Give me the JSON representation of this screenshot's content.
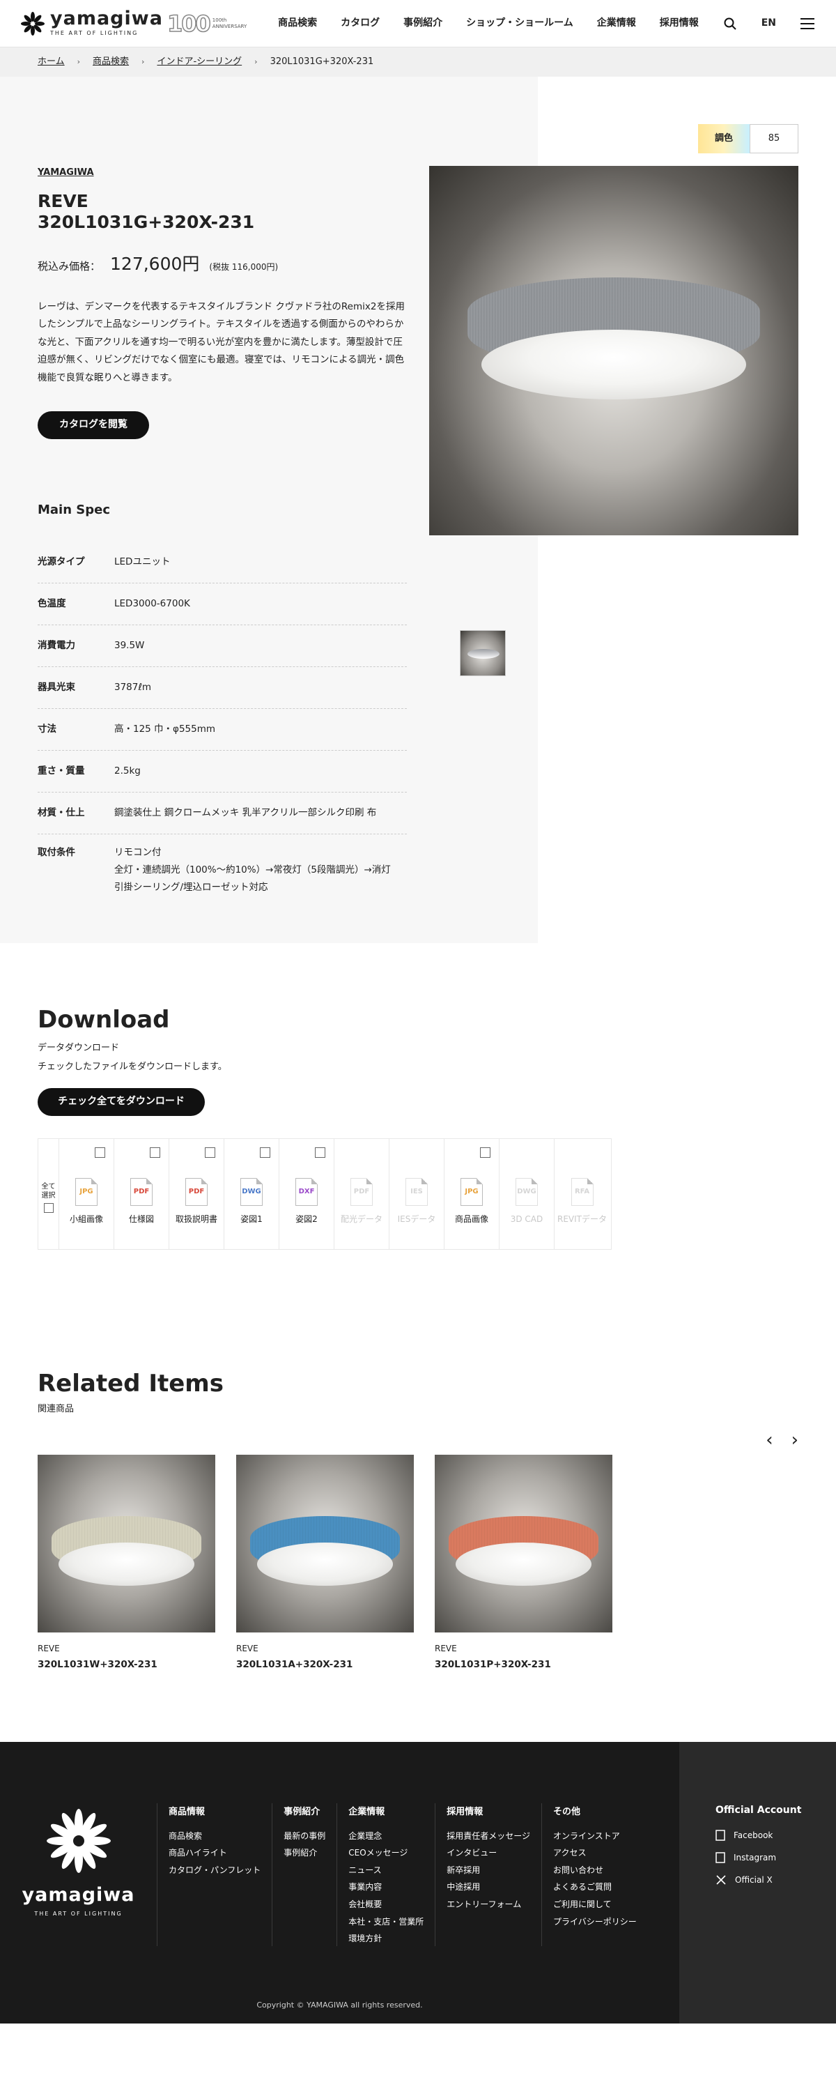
{
  "header": {
    "logo_text": "yamagiwa",
    "logo_sub": "THE ART OF LIGHTING",
    "anniv_number": "100",
    "anniv_text1": "100th",
    "anniv_text2": "ANNIVERSARY",
    "nav": [
      "商品検索",
      "カタログ",
      "事例紹介",
      "ショップ・ショールーム",
      "企業情報",
      "採用情報"
    ],
    "search_icon": "search-icon",
    "lang": "EN",
    "menu_icon": "menu-icon"
  },
  "breadcrumb": [
    "ホーム",
    "商品検索",
    "インドア-シーリング",
    "320L1031G+320X-231"
  ],
  "product": {
    "maker": "YAMAGIWA",
    "name_line1": "REVE",
    "name_line2": "320L1031G+320X-231",
    "price_label": "税込み価格：",
    "price": "127,600円",
    "price_sub": "(税抜 116,000円)",
    "description": "レーヴは、デンマークを代表するテキスタイルブランド クヴァドラ社のRemix2を採用したシンプルで上品なシーリングライト。テキスタイルを透過する側面からのやわらかな光と、下面アクリルを通す均一で明るい光が室内を豊かに満たします。薄型設計で圧迫感が無く、リビングだけでなく個室にも最適。寝室では、リモコンによる調光・調色機能で良質な眠りへと導きます。",
    "catalog_button": "カタログを閲覧",
    "color_label": "調色",
    "color_value": "85"
  },
  "spec": {
    "title": "Main Spec",
    "rows": [
      {
        "k": "光源タイプ",
        "v": "LEDユニット"
      },
      {
        "k": "色温度",
        "v": "LED3000-6700K"
      },
      {
        "k": "消費電力",
        "v": "39.5W"
      },
      {
        "k": "器具光束",
        "v": "3787ℓm"
      },
      {
        "k": "寸法",
        "v": "高・125 巾・φ555mm"
      },
      {
        "k": "重さ・質量",
        "v": "2.5kg"
      },
      {
        "k": "材質・仕上",
        "v": "鋼塗装仕上 鋼クロームメッキ 乳半アクリル一部シルク印刷 布"
      },
      {
        "k": "取付条件",
        "v1": "リモコン付",
        "v2": "全灯・連続調光（100%〜約10%）→常夜灯（5段階調光）→消灯",
        "v3": "引掛シーリング/埋込ローゼット対応"
      }
    ]
  },
  "download": {
    "title": "Download",
    "sub": "データダウンロード",
    "sub2": "チェックしたファイルをダウンロードします。",
    "button": "チェック全てをダウンロード",
    "select_all": "全て選択",
    "files": [
      {
        "type": "JPG",
        "label": "小組画像",
        "color": "#e8a33d",
        "enabled": true
      },
      {
        "type": "PDF",
        "label": "仕様図",
        "color": "#d84a3c",
        "enabled": true
      },
      {
        "type": "PDF",
        "label": "取扱説明書",
        "color": "#d84a3c",
        "enabled": true
      },
      {
        "type": "DWG",
        "label": "姿図1",
        "color": "#4a79c9",
        "enabled": true
      },
      {
        "type": "DXF",
        "label": "姿図2",
        "color": "#9a4ac9",
        "enabled": true
      },
      {
        "type": "PDF",
        "label": "配光データ",
        "color": "#d84a3c",
        "enabled": false
      },
      {
        "type": "IES",
        "label": "IESデータ",
        "color": "#4aa9c9",
        "enabled": false
      },
      {
        "type": "JPG",
        "label": "商品画像",
        "color": "#e8a33d",
        "enabled": true
      },
      {
        "type": "DWG",
        "label": "3D CAD",
        "color": "#4a79c9",
        "enabled": false
      },
      {
        "type": "RFA",
        "label": "REVITデータ",
        "color": "#4a79c9",
        "enabled": false
      }
    ]
  },
  "related": {
    "title": "Related Items",
    "sub": "関連商品",
    "prev_icon": "chevron-left-icon",
    "next_icon": "chevron-right-icon",
    "items": [
      {
        "maker": "REVE",
        "code": "320L1031W+320X-231",
        "color": "#d4d1bd"
      },
      {
        "maker": "REVE",
        "code": "320L1031A+320X-231",
        "color": "#4a8fc0"
      },
      {
        "maker": "REVE",
        "code": "320L1031P+320X-231",
        "color": "#d97a5f"
      }
    ]
  },
  "footer": {
    "logo_text": "yamagiwa",
    "logo_sub": "THE ART OF LIGHTING",
    "cols": [
      {
        "title": "商品情報",
        "links": [
          "商品検索",
          "商品ハイライト",
          "カタログ・パンフレット"
        ]
      },
      {
        "title": "事例紹介",
        "links": [
          "最新の事例",
          "事例紹介"
        ]
      },
      {
        "title": "企業情報",
        "links": [
          "企業理念",
          "CEOメッセージ",
          "ニュース",
          "事業内容",
          "会社概要",
          "本社・支店・営業所",
          "環境方針"
        ]
      },
      {
        "title": "採用情報",
        "links": [
          "採用責任者メッセージ",
          "インタビュー",
          "新卒採用",
          "中途採用",
          "エントリーフォーム"
        ]
      },
      {
        "title": "その他",
        "links": [
          "オンラインストア",
          "アクセス",
          "お問い合わせ",
          "よくあるご質問",
          "ご利用に関して",
          "プライバシーポリシー"
        ]
      }
    ],
    "official_title": "Official Account",
    "sns": [
      "Facebook",
      "Instagram",
      "Official X"
    ],
    "copyright": "Copyright © YAMAGIWA all rights reserved."
  }
}
